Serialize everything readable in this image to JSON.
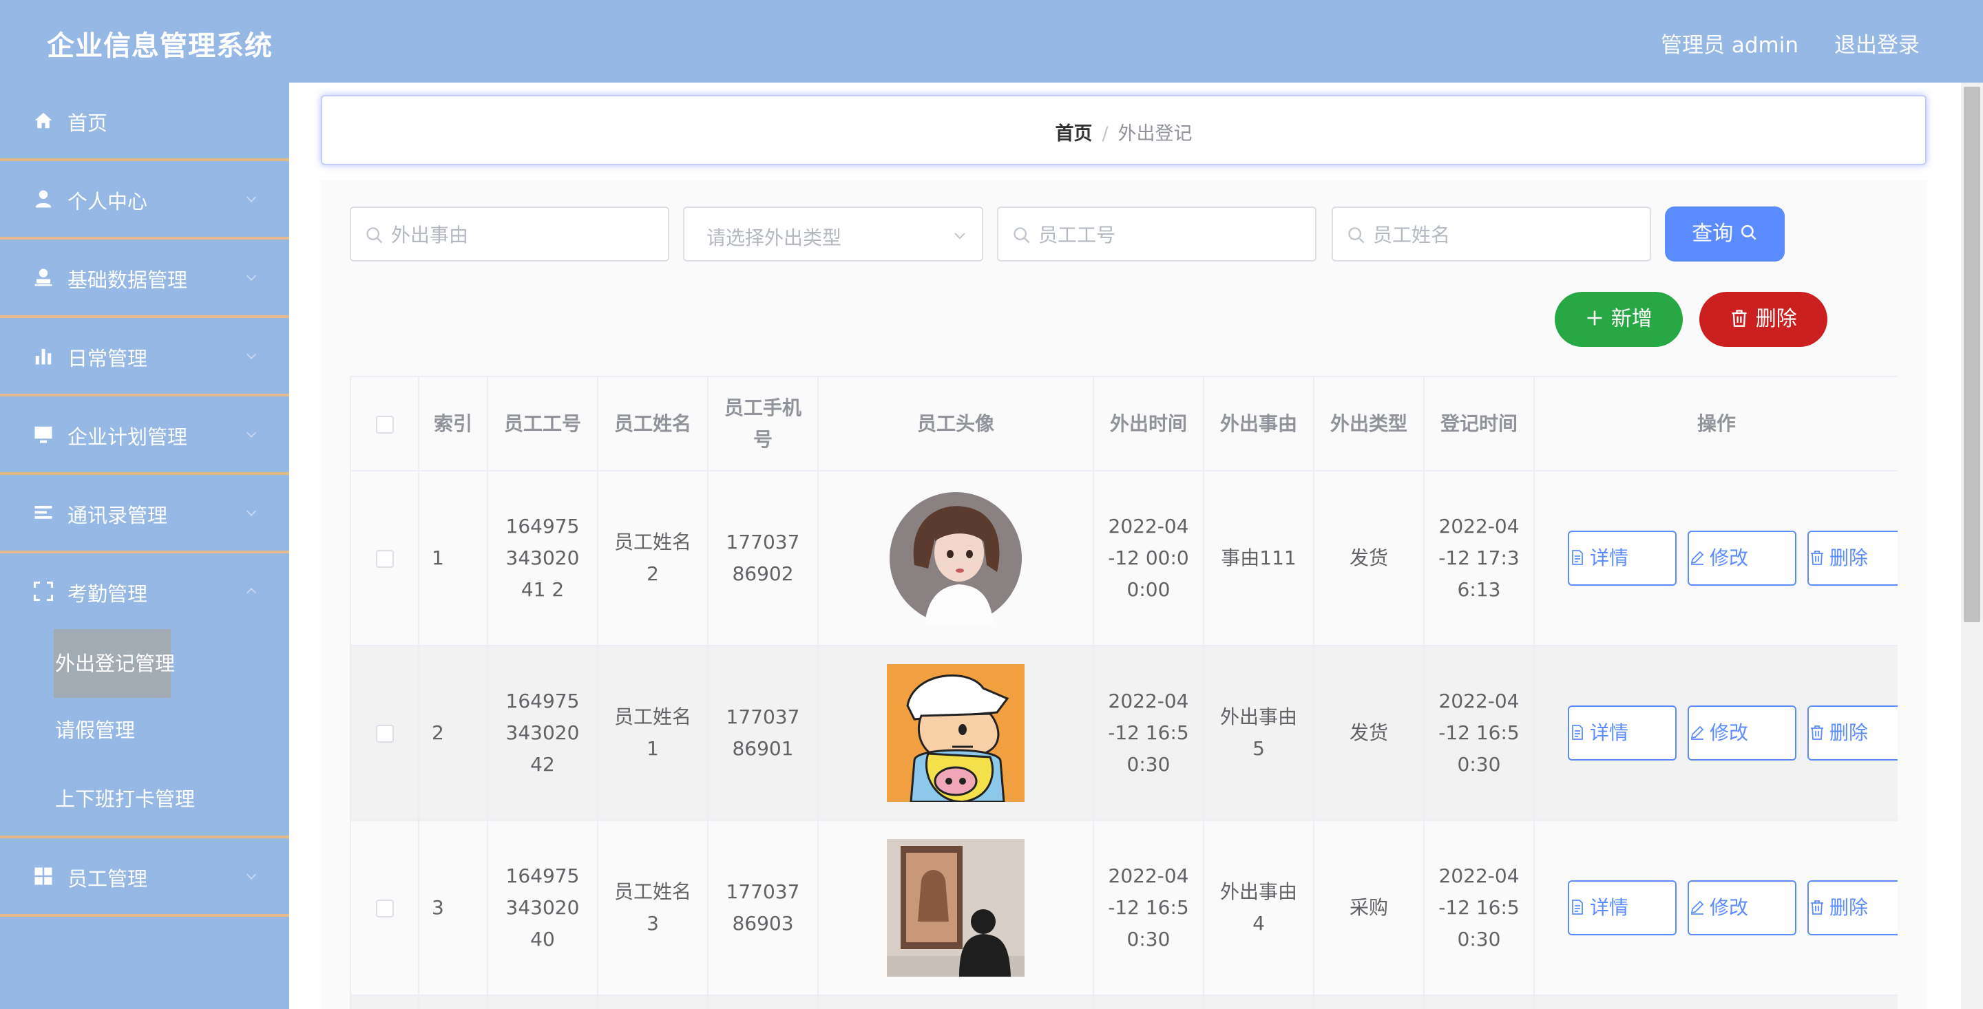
{
  "header": {
    "title": "企业信息管理系统",
    "admin_label": "管理员 admin",
    "logout": "退出登录"
  },
  "sidebar": {
    "items": [
      {
        "label": "首页",
        "icon": "home-icon"
      },
      {
        "label": "个人中心",
        "icon": "user-icon"
      },
      {
        "label": "基础数据管理",
        "icon": "stamp-icon"
      },
      {
        "label": "日常管理",
        "icon": "bar-chart-icon"
      },
      {
        "label": "企业计划管理",
        "icon": "monitor-icon"
      },
      {
        "label": "通讯录管理",
        "icon": "list-icon"
      },
      {
        "label": "考勤管理",
        "icon": "frame-icon"
      },
      {
        "label": "员工管理",
        "icon": "grid-icon"
      }
    ],
    "sub_items": [
      {
        "label": "外出登记管理"
      },
      {
        "label": "请假管理"
      },
      {
        "label": "上下班打卡管理"
      }
    ]
  },
  "breadcrumb": {
    "home": "首页",
    "separator": "/",
    "current": "外出登记"
  },
  "search": {
    "reason_placeholder": "外出事由",
    "type_placeholder": "请选择外出类型",
    "emp_no_placeholder": "员工工号",
    "emp_name_placeholder": "员工姓名",
    "query_label": "查询"
  },
  "actions": {
    "add_label": "新增",
    "delete_label": "删除"
  },
  "table": {
    "columns": [
      "索引",
      "员工工号",
      "员工姓名",
      "员工手机号",
      "员工头像",
      "外出时间",
      "外出事由",
      "外出类型",
      "登记时间",
      "操作"
    ],
    "rows": [
      {
        "index": "1",
        "emp_no": "16497534302041 2",
        "emp_name": "员工姓名2",
        "phone": "17703786902",
        "avatar": "avatar-girl",
        "out_time": "2022-04-12 00:00:00",
        "reason": "事由111",
        "type": "发货",
        "reg_time": "2022-04-12 17:36:13"
      },
      {
        "index": "2",
        "emp_no": "16497534302042",
        "emp_name": "员工姓名1",
        "phone": "17703786901",
        "avatar": "avatar-cartoon",
        "out_time": "2022-04-12 16:50:30",
        "reason": "外出事由5",
        "type": "发货",
        "reg_time": "2022-04-12 16:50:30"
      },
      {
        "index": "3",
        "emp_no": "16497534302040",
        "emp_name": "员工姓名3",
        "phone": "17703786903",
        "avatar": "avatar-photo",
        "out_time": "2022-04-12 16:50:30",
        "reason": "外出事由4",
        "type": "采购",
        "reg_time": "2022-04-12 16:50:30"
      }
    ],
    "op_detail": "详情",
    "op_edit": "修改",
    "op_delete": "删除"
  },
  "colors": {
    "header_bg": "#95b8e5",
    "primary": "#5b8cff",
    "success": "#27a844",
    "danger": "#cc2020",
    "divider": "#e5b98a"
  }
}
